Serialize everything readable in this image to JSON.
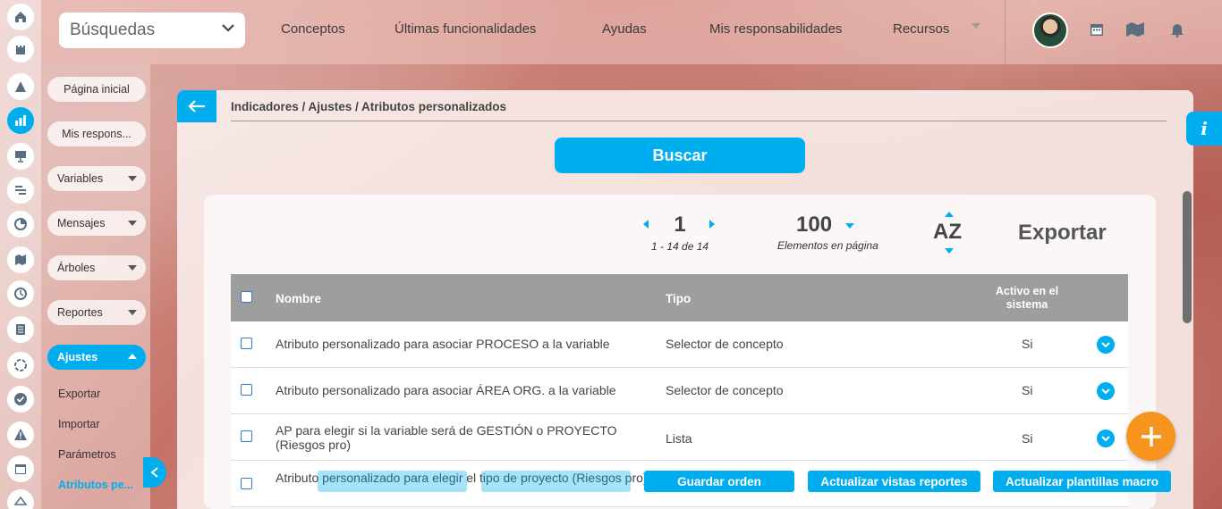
{
  "topbar": {
    "search_label": "Búsquedas",
    "nav": [
      "Conceptos",
      "Últimas funcionalidades",
      "Ayudas",
      "Mis responsabilidades",
      "Recursos"
    ]
  },
  "sidebar": {
    "pills": [
      {
        "label": "Página inicial"
      },
      {
        "label": "Mis respons..."
      },
      {
        "label": "Variables"
      },
      {
        "label": "Mensajes"
      },
      {
        "label": "Árboles"
      },
      {
        "label": "Reportes"
      },
      {
        "label": "Ajustes"
      }
    ],
    "ajustes_links": [
      "Exportar",
      "Importar",
      "Parámetros",
      "Atributos pe..."
    ]
  },
  "main": {
    "breadcrumb": "Indicadores / Ajustes / Atributos personalizados",
    "search_button": "Buscar",
    "pagination": {
      "current": "1",
      "range": "1 - 14 de 14"
    },
    "per_page": {
      "value": "100",
      "label": "Elementos en página"
    },
    "sort_label": "AZ",
    "export_label": "Exportar",
    "table": {
      "headers": [
        "Nombre",
        "Tipo",
        "Activo en el sistema"
      ],
      "rows": [
        {
          "name": "Atributo personalizado para asociar PROCESO a la variable",
          "tipo": "Selector de concepto",
          "activo": "Si"
        },
        {
          "name": "Atributo personalizado para asociar ÁREA ORG. a la variable",
          "tipo": "Selector de concepto",
          "activo": "Si"
        },
        {
          "name": "AP para elegir si la variable será de GESTIÓN o PROYECTO (Riesgos pro)",
          "tipo": "Lista",
          "activo": "Si"
        },
        {
          "name": "Atributo personalizado para elegir el tipo de proyecto (Riesgos pro)",
          "tipo": "",
          "activo": ""
        }
      ]
    }
  },
  "actions": {
    "guardar": "Guardar orden",
    "actualizar_vistas": "Actualizar vistas reportes",
    "actualizar_plantillas": "Actualizar plantillas macro"
  },
  "colors": {
    "accent": "#00aeef",
    "fab": "#f7941d",
    "header": "#9e9e9e"
  },
  "icons": [
    "home-icon",
    "castle-icon",
    "triangle-icon",
    "chart-icon",
    "presentation-icon",
    "gantt-icon",
    "pie-icon",
    "map-icon",
    "clock-icon",
    "list-icon",
    "cycle-icon",
    "check-icon",
    "alert-icon",
    "calendar-icon",
    "network-icon",
    "calendar-icon",
    "map-icon",
    "bell-icon",
    "plus-icon",
    "info-icon"
  ]
}
